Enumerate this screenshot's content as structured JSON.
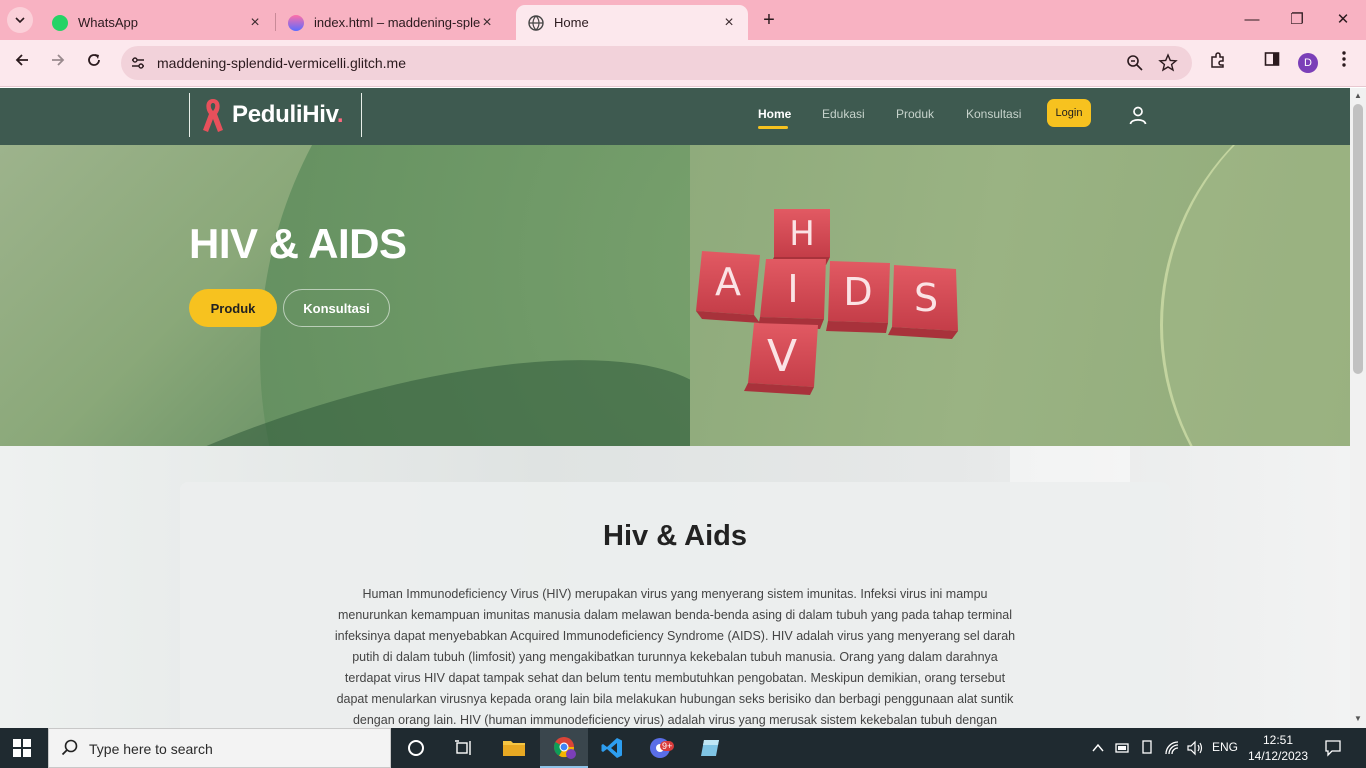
{
  "browser": {
    "tabs": [
      {
        "title": "WhatsApp",
        "favicon": "whatsapp-icon"
      },
      {
        "title": "index.html – maddening-splendid-vermicelli",
        "favicon": "glitch-icon"
      },
      {
        "title": "Home",
        "favicon": "globe-icon",
        "active": true
      }
    ],
    "url": "maddening-splendid-vermicelli.glitch.me",
    "profile_initial": "D"
  },
  "site": {
    "brand": {
      "name": "PeduliHiv",
      "dot": "."
    },
    "nav": {
      "home": "Home",
      "edukasi": "Edukasi",
      "produk": "Produk",
      "konsultasi": "Konsultasi"
    },
    "login_label": "Login",
    "hero": {
      "title": "HIV & AIDS",
      "btn_produk": "Produk",
      "btn_konsultasi": "Konsultasi",
      "cube_letters": {
        "h": "H",
        "a": "A",
        "i": "I",
        "d": "D",
        "s": "S",
        "v": "V"
      }
    },
    "about": {
      "title": "Hiv & Aids",
      "body": "Human Immunodeficiency Virus (HIV) merupakan virus yang menyerang sistem imunitas. Infeksi virus ini mampu menurunkan kemampuan imunitas manusia dalam melawan benda-benda asing di dalam tubuh yang pada tahap terminal infeksinya dapat menyebabkan Acquired Immunodeficiency Syndrome (AIDS). HIV adalah virus yang menyerang sel darah putih di dalam tubuh (limfosit) yang mengakibatkan turunnya kekebalan tubuh manusia. Orang yang dalam darahnya terdapat virus HIV dapat tampak sehat dan belum tentu membutuhkan pengobatan. Meskipun demikian, orang tersebut dapat menularkan virusnya kepada orang lain bila melakukan hubungan seks berisiko dan berbagi penggunaan alat suntik dengan orang lain. HIV (human immunodeficiency virus) adalah virus yang merusak sistem kekebalan tubuh dengan"
    }
  },
  "taskbar": {
    "search_placeholder": "Type here to search",
    "language": "ENG",
    "time": "12:51",
    "date": "14/12/2023",
    "badge": "9+"
  },
  "colors": {
    "header": "#3e5a50",
    "accent": "#f7c21f",
    "ribbon": "#e8505b",
    "chrome": "#f8b2c2"
  }
}
